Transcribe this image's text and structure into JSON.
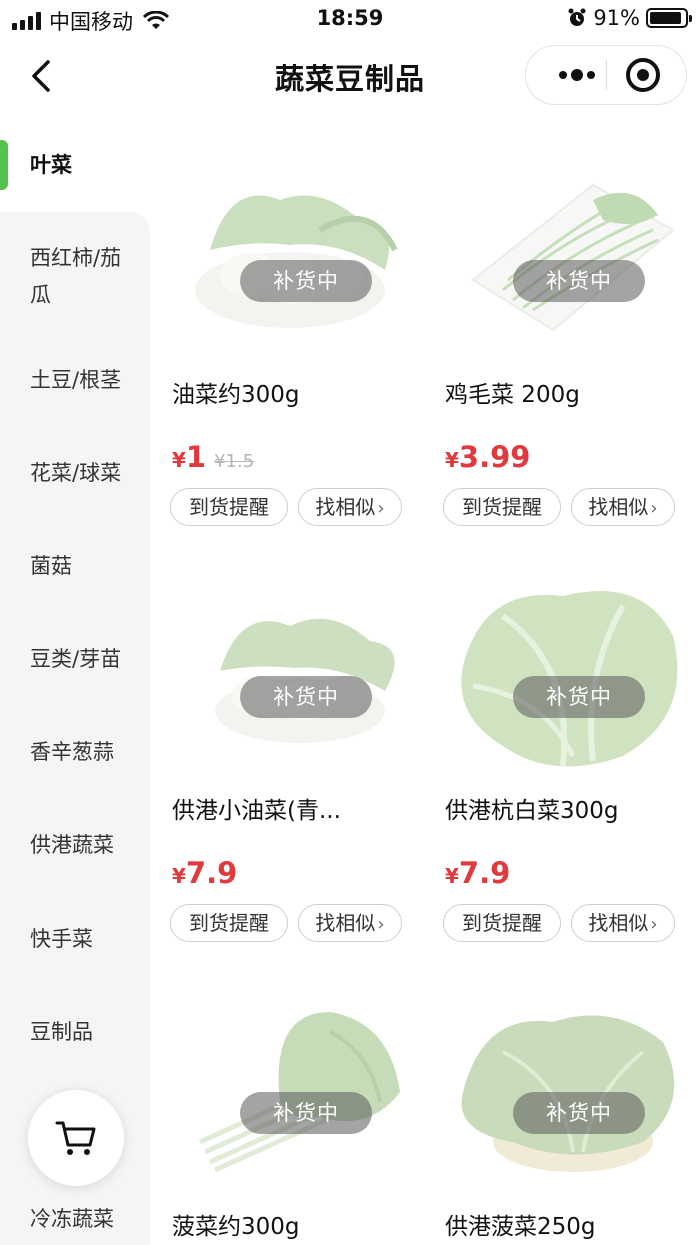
{
  "status_bar": {
    "carrier": "中国移动",
    "time": "18:59",
    "battery": "91%",
    "battery_level": 0.91
  },
  "nav": {
    "title": "蔬菜豆制品",
    "back_icon": "chevron-left-icon",
    "more_icon": "more-dots-icon",
    "target_icon": "target-icon"
  },
  "sidebar": {
    "items": [
      {
        "label": "叶菜",
        "active": true
      },
      {
        "label": "西红柿/茄瓜"
      },
      {
        "label": "土豆/根茎"
      },
      {
        "label": "花菜/球菜"
      },
      {
        "label": "菌菇"
      },
      {
        "label": "豆类/芽苗"
      },
      {
        "label": "香辛葱蒜"
      },
      {
        "label": "供港蔬菜"
      },
      {
        "label": "快手菜"
      },
      {
        "label": "豆制品"
      },
      {
        "label": "冷冻蔬菜"
      }
    ],
    "cart_icon": "cart-icon",
    "accent_color": "#54c04e"
  },
  "products": [
    {
      "name": "油菜约300g",
      "currency": "¥",
      "price": "1",
      "original_price": "¥1.5",
      "status": "补货中",
      "remind_label": "到货提醒",
      "similar_label": "找相似"
    },
    {
      "name": "鸡毛菜 200g",
      "currency": "¥",
      "price": "3.99",
      "original_price": "",
      "status": "补货中",
      "remind_label": "到货提醒",
      "similar_label": "找相似"
    },
    {
      "name": "供港小油菜(青...",
      "currency": "¥",
      "price": "7.9",
      "original_price": "",
      "status": "补货中",
      "remind_label": "到货提醒",
      "similar_label": "找相似"
    },
    {
      "name": "供港杭白菜300g",
      "currency": "¥",
      "price": "7.9",
      "original_price": "",
      "status": "补货中",
      "remind_label": "到货提醒",
      "similar_label": "找相似"
    },
    {
      "name": "菠菜约300g",
      "currency": "",
      "price": "",
      "original_price": "",
      "status": "补货中",
      "remind_label": "",
      "similar_label": ""
    },
    {
      "name": "供港菠菜250g",
      "currency": "",
      "price": "",
      "original_price": "",
      "status": "补货中",
      "remind_label": "",
      "similar_label": ""
    }
  ],
  "colors": {
    "price": "#e0393e",
    "active_indicator": "#54c04e"
  }
}
